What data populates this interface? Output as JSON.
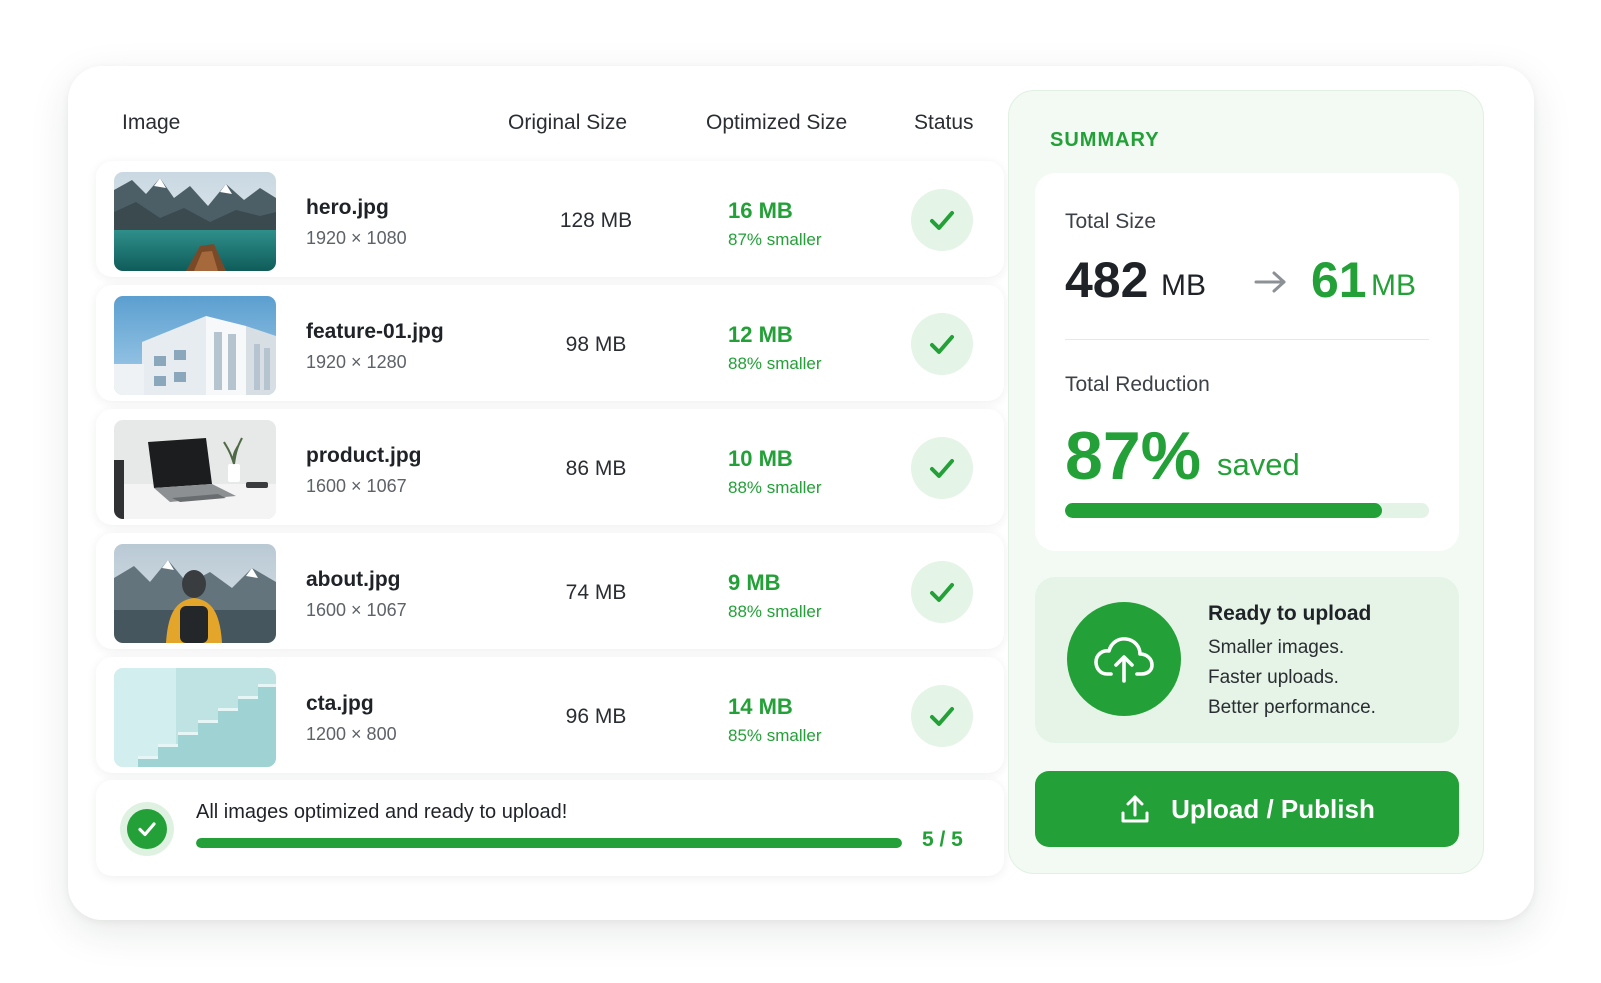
{
  "table": {
    "headers": {
      "image": "Image",
      "original": "Original Size",
      "optimized": "Optimized Size",
      "status": "Status"
    },
    "rows": [
      {
        "name": "hero.jpg",
        "dims": "1920 × 1080",
        "original": "128 MB",
        "optimized": "16 MB",
        "reduction": "87% smaller",
        "thumb": "mountain-lake"
      },
      {
        "name": "feature-01.jpg",
        "dims": "1920 × 1280",
        "original": "98 MB",
        "optimized": "12 MB",
        "reduction": "88% smaller",
        "thumb": "white-building"
      },
      {
        "name": "product.jpg",
        "dims": "1600 × 1067",
        "original": "86 MB",
        "optimized": "10 MB",
        "reduction": "88% smaller",
        "thumb": "laptop-desk"
      },
      {
        "name": "about.jpg",
        "dims": "1600 × 1067",
        "original": "74 MB",
        "optimized": "9 MB",
        "reduction": "88% smaller",
        "thumb": "hiker-mountains"
      },
      {
        "name": "cta.jpg",
        "dims": "1200 × 800",
        "original": "96 MB",
        "optimized": "14 MB",
        "reduction": "85% smaller",
        "thumb": "mint-stairs"
      }
    ]
  },
  "footer": {
    "message": "All images optimized and ready to upload!",
    "count": "5 / 5",
    "progress": 1.0
  },
  "summary": {
    "title": "SUMMARY",
    "total_size_label": "Total Size",
    "from_value": "482",
    "from_unit": "MB",
    "to_value": "61",
    "to_unit": "MB",
    "total_reduction_label": "Total Reduction",
    "reduction_value": "87%",
    "reduction_suffix": "saved",
    "reduction_progress": 0.87
  },
  "ready": {
    "title": "Ready to upload",
    "lines": [
      "Smaller images.",
      "Faster uploads.",
      "Better performance."
    ]
  },
  "upload_button": {
    "label": "Upload / Publish"
  },
  "colors": {
    "accent": "#23a037",
    "accent_soft": "#e4f4e6",
    "panel_bg": "#f2faf3"
  },
  "icons": {
    "status": "check-icon",
    "footer": "check-circle-icon",
    "arrow": "arrow-right-icon",
    "cloud": "cloud-upload-icon",
    "button": "upload-icon"
  }
}
